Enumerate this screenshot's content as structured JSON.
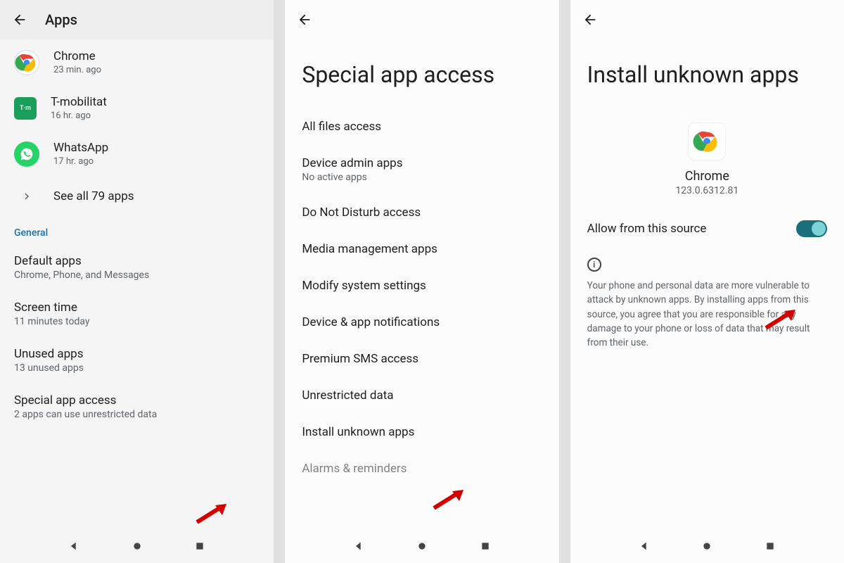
{
  "screen1": {
    "title": "Apps",
    "apps": [
      {
        "name": "Chrome",
        "sub": "23 min. ago",
        "icon": "chrome"
      },
      {
        "name": "T-mobilitat",
        "sub": "16 hr. ago",
        "icon": "tmob"
      },
      {
        "name": "WhatsApp",
        "sub": "17 hr. ago",
        "icon": "whatsapp"
      }
    ],
    "see_all": "See all 79 apps",
    "section": "General",
    "settings": [
      {
        "title": "Default apps",
        "sub": "Chrome, Phone, and Messages"
      },
      {
        "title": "Screen time",
        "sub": "11 minutes today"
      },
      {
        "title": "Unused apps",
        "sub": "13 unused apps"
      },
      {
        "title": "Special app access",
        "sub": "2 apps can use unrestricted data"
      }
    ]
  },
  "screen2": {
    "title": "Special app access",
    "items": [
      {
        "title": "All files access",
        "sub": ""
      },
      {
        "title": "Device admin apps",
        "sub": "No active apps"
      },
      {
        "title": "Do Not Disturb access",
        "sub": ""
      },
      {
        "title": "Media management apps",
        "sub": ""
      },
      {
        "title": "Modify system settings",
        "sub": ""
      },
      {
        "title": "Device & app notifications",
        "sub": ""
      },
      {
        "title": "Premium SMS access",
        "sub": ""
      },
      {
        "title": "Unrestricted data",
        "sub": ""
      },
      {
        "title": "Install unknown apps",
        "sub": ""
      },
      {
        "title": "Alarms & reminders",
        "sub": ""
      }
    ]
  },
  "screen3": {
    "title": "Install unknown apps",
    "app_name": "Chrome",
    "app_version": "123.0.6312.81",
    "toggle_label": "Allow from this source",
    "toggle_on": true,
    "info": "Your phone and personal data are more vulnerable to attack by unknown apps. By installing apps from this source, you agree that you are responsible for any damage to your phone or loss of data that may result from their use."
  },
  "icons": {
    "tmob_label": "T·m"
  }
}
